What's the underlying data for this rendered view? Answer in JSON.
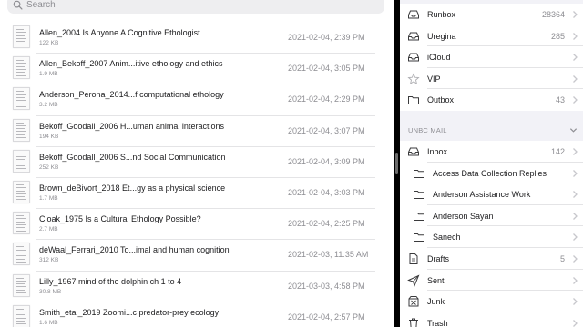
{
  "files": {
    "search_placeholder": "Search",
    "items": [
      {
        "name": "Allen_2004 Is Anyone A Cognitive Ethologist",
        "size": "122 KB",
        "date": "2021-02-04, 2:39 PM"
      },
      {
        "name": "Allen_Bekoff_2007 Anim...itive ethology and ethics",
        "size": "1.9 MB",
        "date": "2021-02-04, 3:05 PM"
      },
      {
        "name": "Anderson_Perona_2014...f computational ethology",
        "size": "3.2 MB",
        "date": "2021-02-04, 2:29 PM"
      },
      {
        "name": "Bekoff_Goodall_2006 H...uman animal interactions",
        "size": "194 KB",
        "date": "2021-02-04, 3:07 PM"
      },
      {
        "name": "Bekoff_Goodall_2006 S...nd Social Communication",
        "size": "252 KB",
        "date": "2021-02-04, 3:09 PM"
      },
      {
        "name": "Brown_deBivort_2018 Et...gy as a physical science",
        "size": "1.7 MB",
        "date": "2021-02-04, 3:03 PM"
      },
      {
        "name": "Cloak_1975 Is a Cultural Ethology Possible?",
        "size": "2.7 MB",
        "date": "2021-02-04, 2:25 PM"
      },
      {
        "name": "deWaal_Ferrari_2010 To...imal and human cognition",
        "size": "312 KB",
        "date": "2021-02-03, 11:35 AM"
      },
      {
        "name": "Lilly_1967 mind of the dolphin ch 1 to 4",
        "size": "30.8 MB",
        "date": "2021-03-03, 4:58 PM"
      },
      {
        "name": "Smith_etal_2019 Zoomi...c predator-prey ecology",
        "size": "1.6 MB",
        "date": "2021-02-04, 2:57 PM"
      }
    ]
  },
  "mail": {
    "top_group": [
      {
        "label": "Runbox",
        "count": "28364",
        "icon": "tray-icon"
      },
      {
        "label": "Uregina",
        "count": "285",
        "icon": "tray-icon"
      },
      {
        "label": "iCloud",
        "count": "",
        "icon": "tray-icon"
      },
      {
        "label": "VIP",
        "count": "",
        "icon": "star-icon"
      },
      {
        "label": "Outbox",
        "count": "43",
        "icon": "folder-icon"
      }
    ],
    "section_title": "UNBC MAIL",
    "unbc_group": [
      {
        "label": "Inbox",
        "count": "142",
        "icon": "tray-icon",
        "sub": false
      },
      {
        "label": "Access Data Collection Replies",
        "count": "",
        "icon": "folder-icon",
        "sub": true
      },
      {
        "label": "Anderson Assistance Work",
        "count": "",
        "icon": "folder-icon",
        "sub": true
      },
      {
        "label": "Anderson Sayan",
        "count": "",
        "icon": "folder-icon",
        "sub": true
      },
      {
        "label": "Sanech",
        "count": "",
        "icon": "folder-icon",
        "sub": true
      },
      {
        "label": "Drafts",
        "count": "5",
        "icon": "draft-icon",
        "sub": false
      },
      {
        "label": "Sent",
        "count": "",
        "icon": "sent-icon",
        "sub": false
      },
      {
        "label": "Junk",
        "count": "",
        "icon": "junk-icon",
        "sub": false
      },
      {
        "label": "Trash",
        "count": "",
        "icon": "trash-icon",
        "sub": false
      }
    ],
    "colors": {
      "icon": "#3a3a3c",
      "chevron": "#c7c7cc"
    }
  }
}
